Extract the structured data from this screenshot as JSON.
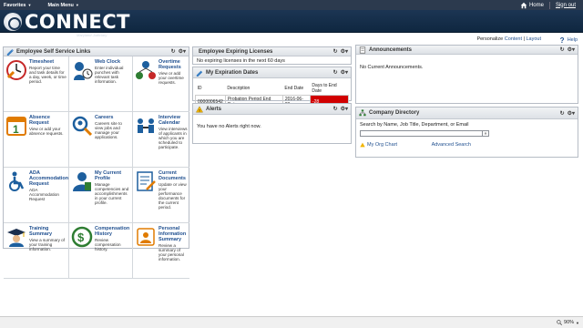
{
  "menubar": {
    "favorites": "Favorites",
    "main_menu": "Main Menu",
    "home": "Home",
    "sign_out": "Sign out"
  },
  "banner": {
    "logo_text": "CONNECT",
    "logo_sub": "Maryland Judiciary"
  },
  "toolbar": {
    "personalize": "Personalize",
    "content": "Content",
    "separator": "|",
    "layout": "Layout",
    "help": "Help"
  },
  "ess": {
    "title": "Employee Self Service Links",
    "refresh_glyph": "↻",
    "options_glyph": "⚙▾",
    "tiles": [
      {
        "title": "Timesheet",
        "desc": "Report your time and task details for a day, week, or time period.",
        "icon": "timesheet-icon"
      },
      {
        "title": "Web Clock",
        "desc": "Enter individual punches with relevant task information.",
        "icon": "web-clock-icon"
      },
      {
        "title": "Overtime Requests",
        "desc": "View or add your overtime requests.",
        "icon": "overtime-icon"
      },
      {
        "title": "Absence Request",
        "desc": "View or add your absence requests.",
        "icon": "calendar-icon"
      },
      {
        "title": "Careers",
        "desc": "Careers site to view jobs and manage your applications.",
        "icon": "careers-icon"
      },
      {
        "title": "Interview Calendar",
        "desc": "View interviews of applicants in which you are scheduled to participate.",
        "icon": "interview-icon"
      },
      {
        "title": "ADA Accommodation Request",
        "desc": "ADA Accommodation Request",
        "icon": "wheelchair-icon"
      },
      {
        "title": "My Current Profile",
        "desc": "Manage competencies and accomplishments in your current profile.",
        "icon": "profile-icon"
      },
      {
        "title": "Current Documents",
        "desc": "Update or view your performance documents for the current period.",
        "icon": "documents-icon"
      },
      {
        "title": "Training Summary",
        "desc": "View a summary of your training information.",
        "icon": "training-icon"
      },
      {
        "title": "Compensation History",
        "desc": "Review compensation history.",
        "icon": "compensation-icon"
      },
      {
        "title": "Personal Information Summary",
        "desc": "Review a summary of your personal information.",
        "icon": "personal-info-icon"
      }
    ]
  },
  "expiring": {
    "title": "Employee Expiring Licenses",
    "message": "No expiring licenses in the next 60 days"
  },
  "expiration": {
    "title": "My Expiration Dates",
    "headers": [
      "ID",
      "Description",
      "End Date",
      "Days to End Date"
    ],
    "rows": [
      {
        "id": "0000006542",
        "desc": "Probation Period End Date",
        "end": "2016-06-23",
        "days": "-28"
      }
    ]
  },
  "alerts": {
    "title": "Alerts",
    "message": "You have no Alerts right now."
  },
  "announcements": {
    "title": "Announcements",
    "message": "No Current Announcements."
  },
  "directory": {
    "title": "Company Directory",
    "search_label": "Search by Name, Job Title, Department, or Email",
    "go": "»",
    "org_chart": "My Org Chart",
    "advanced": "Advanced Search"
  },
  "status": {
    "zoom": "90%"
  },
  "colors": {
    "header_bg": "#2c3a4e",
    "banner_bg": "#1c3553",
    "link": "#1f4f8f",
    "alert_red": "#d10000"
  }
}
